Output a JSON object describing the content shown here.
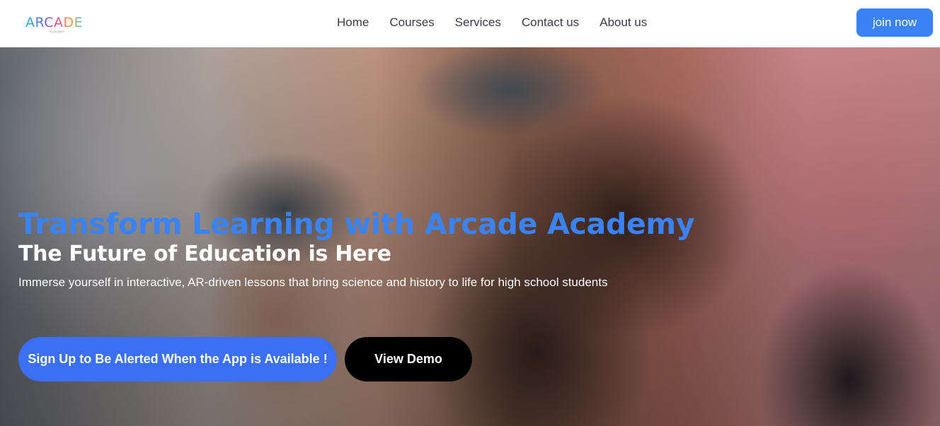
{
  "header": {
    "logo_text": "ARCADE",
    "logo_subtext": "ACADEMY",
    "nav_items": [
      {
        "label": "Home"
      },
      {
        "label": "Courses"
      },
      {
        "label": "Services"
      },
      {
        "label": "Contact us"
      },
      {
        "label": "About us"
      }
    ],
    "join_label": "join now"
  },
  "hero": {
    "title": "Transform Learning with Arcade Academy",
    "subtitle": "The Future of Education is Here",
    "description": "Immerse yourself in interactive, AR-driven lessons that bring science and history to life for high school students",
    "primary_cta": "Sign Up to Be Alerted When the App is Available !",
    "secondary_cta": "View Demo"
  },
  "colors": {
    "accent": "#3b82f6",
    "primary_button": "#3b6ff6",
    "secondary_button": "#000000",
    "nav_text": "#3a3a4a"
  }
}
